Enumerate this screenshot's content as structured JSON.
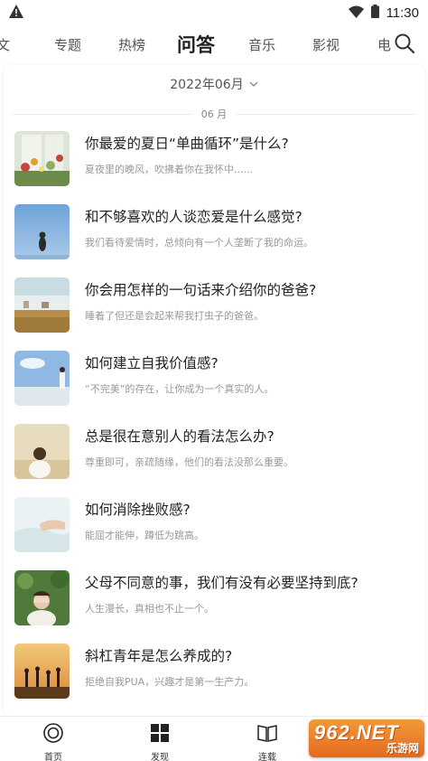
{
  "status_bar": {
    "time": "11:30",
    "icons": [
      "warning-icon",
      "wifi-icon",
      "battery-icon"
    ]
  },
  "tabs": [
    {
      "label": "文",
      "active": false
    },
    {
      "label": "专题",
      "active": false
    },
    {
      "label": "热榜",
      "active": false
    },
    {
      "label": "问答",
      "active": true
    },
    {
      "label": "音乐",
      "active": false
    },
    {
      "label": "影视",
      "active": false
    },
    {
      "label": "电",
      "active": false
    }
  ],
  "search_icon": "search-icon",
  "date_picker": {
    "value": "2022年06月"
  },
  "month_divider": "06 月",
  "items": [
    {
      "title": "你最爱的夏日“单曲循环”是什么?",
      "subtitle": "夏夜里的晚风，吹拂着你在我怀中......",
      "thumb": "flowers-window"
    },
    {
      "title": "和不够喜欢的人谈恋爱是什么感觉?",
      "subtitle": "我们看待爱情时，总倾向有一个人垄断了我的命运。",
      "thumb": "girl-blue-sky"
    },
    {
      "title": "你会用怎样的一句话来介绍你的爸爸?",
      "subtitle": "睡着了但还是会起来帮我打虫子的爸爸。",
      "thumb": "field-landscape"
    },
    {
      "title": "如何建立自我价值感?",
      "subtitle": "“不完美”的存在，让你成为一个真实的人。",
      "thumb": "girl-beach"
    },
    {
      "title": "总是很在意别人的看法怎么办?",
      "subtitle": "尊重即可，亲疏随缘，他们的看法没那么重要。",
      "thumb": "girl-field"
    },
    {
      "title": "如何消除挫败感?",
      "subtitle": "能屈才能伸，蹲低为跳高。",
      "thumb": "hands-water"
    },
    {
      "title": "父母不同意的事，我们有没有必要坚持到底?",
      "subtitle": "人生漫长，真相也不止一个。",
      "thumb": "girl-covering-face"
    },
    {
      "title": "斜杠青年是怎么养成的?",
      "subtitle": "拒绝自我PUA，兴趣才是第一生产力。",
      "thumb": "sunset-people"
    }
  ],
  "bottom_nav": [
    {
      "label": "首页",
      "icon": "home-circle-icon"
    },
    {
      "label": "发现",
      "icon": "grid-icon"
    },
    {
      "label": "连载",
      "icon": "book-icon"
    }
  ],
  "watermark": {
    "top": "962.NET",
    "bottom": "乐游网"
  },
  "colors": {
    "accent": "#222222",
    "subtitle": "#999999",
    "watermark": "#e8782a"
  }
}
